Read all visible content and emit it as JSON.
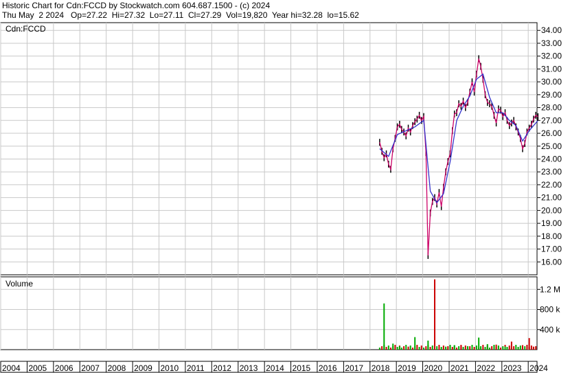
{
  "header": {
    "line1": "Historic Chart for Cdn:FCCD by Stockwatch.com 604.687.1500 - (c) 2024",
    "line2": "Thu May  2 2024   Op=27.22  Hi=27.32  Lo=27.11  Cl=27.29  Vol=19,820  Year hi=32.28  lo=15.62"
  },
  "price_panel": {
    "label": "Cdn:FCCD"
  },
  "volume_panel": {
    "label": "Volume"
  },
  "chart_data": [
    {
      "type": "line",
      "title": "Cdn:FCCD",
      "x_axis_years": [
        "2004",
        "2005",
        "2006",
        "2007",
        "2008",
        "2009",
        "2010",
        "2011",
        "2012",
        "2013",
        "2014",
        "2015",
        "2016",
        "2017",
        "2018",
        "2019",
        "2020",
        "2021",
        "2022",
        "2023",
        "2024"
      ],
      "xlim": [
        "2004-01-01",
        "2024-05-02"
      ],
      "ylim": [
        15.0,
        34.6
      ],
      "y_ticks": [
        "34.00",
        "33.00",
        "32.00",
        "31.00",
        "30.00",
        "29.00",
        "28.00",
        "27.00",
        "26.00",
        "25.00",
        "24.00",
        "23.00",
        "22.00",
        "21.00",
        "20.00",
        "19.00",
        "18.00",
        "17.00",
        "16.00"
      ],
      "grid": true,
      "series": [
        {
          "color": "#cc0066",
          "x": [
            "2018-05",
            "2018-06",
            "2018-07",
            "2018-08",
            "2018-09",
            "2018-10",
            "2018-11",
            "2018-12",
            "2019-01",
            "2019-02",
            "2019-03",
            "2019-04",
            "2019-05",
            "2019-06",
            "2019-07",
            "2019-08",
            "2019-09",
            "2019-10",
            "2019-11",
            "2019-12",
            "2020-01",
            "2020-02",
            "2020-03",
            "2020-04",
            "2020-05",
            "2020-06",
            "2020-07",
            "2020-08",
            "2020-09",
            "2020-10",
            "2020-11",
            "2020-12",
            "2021-01",
            "2021-02",
            "2021-03",
            "2021-04",
            "2021-05",
            "2021-06",
            "2021-07",
            "2021-08",
            "2021-09",
            "2021-10",
            "2021-11",
            "2021-12",
            "2022-01",
            "2022-02",
            "2022-03",
            "2022-04",
            "2022-05",
            "2022-06",
            "2022-07",
            "2022-08",
            "2022-09",
            "2022-10",
            "2022-11",
            "2022-12",
            "2023-01",
            "2023-02",
            "2023-03",
            "2023-04",
            "2023-05",
            "2023-06",
            "2023-07",
            "2023-08",
            "2023-09",
            "2023-10",
            "2023-11",
            "2023-12",
            "2024-01",
            "2024-02",
            "2024-03",
            "2024-04",
            "2024-05"
          ],
          "y": [
            25.3,
            24.6,
            24.1,
            24.4,
            23.6,
            23.2,
            24.8,
            25.6,
            26.5,
            26.7,
            26.3,
            26.1,
            25.8,
            26.4,
            26.1,
            26.6,
            26.9,
            27.1,
            27.4,
            27.0,
            27.3,
            24.5,
            16.5,
            19.8,
            20.7,
            21.0,
            20.5,
            21.4,
            20.3,
            21.8,
            23.0,
            23.8,
            24.4,
            26.2,
            27.5,
            27.6,
            28.3,
            28.1,
            28.5,
            28.0,
            28.4,
            29.2,
            30.0,
            29.2,
            30.6,
            31.8,
            31.2,
            30.2,
            29.0,
            28.4,
            28.3,
            28.1,
            27.4,
            26.8,
            27.9,
            27.8,
            27.3,
            27.6,
            27.0,
            26.6,
            26.8,
            27.0,
            26.5,
            26.1,
            25.6,
            24.8,
            25.2,
            26.1,
            26.4,
            26.7,
            27.1,
            27.4,
            27.29
          ]
        },
        {
          "color": "#3333cc",
          "x": [
            "2018-05",
            "2018-09",
            "2019-01",
            "2019-05",
            "2019-09",
            "2020-01",
            "2020-04",
            "2020-07",
            "2020-10",
            "2021-01",
            "2021-04",
            "2021-07",
            "2021-10",
            "2022-01",
            "2022-04",
            "2022-07",
            "2022-10",
            "2023-01",
            "2023-04",
            "2023-07",
            "2023-10",
            "2024-01",
            "2024-05"
          ],
          "y": [
            24.8,
            24.2,
            25.9,
            26.2,
            26.5,
            27.0,
            21.5,
            20.6,
            21.3,
            23.8,
            27.0,
            28.1,
            28.9,
            30.2,
            30.6,
            28.8,
            27.6,
            27.6,
            27.0,
            26.6,
            25.4,
            26.2,
            27.0
          ]
        }
      ]
    },
    {
      "type": "bar",
      "title": "Volume",
      "ylim": [
        0,
        1450000
      ],
      "y_ticks": [
        "1.2 M",
        "800 k",
        "400 k"
      ],
      "green_spikes": [
        {
          "x": "2018-07",
          "value": 920000
        },
        {
          "x": "2018-11",
          "value": 120000
        },
        {
          "x": "2019-02",
          "value": 70000
        },
        {
          "x": "2019-09",
          "value": 250000
        },
        {
          "x": "2020-03",
          "value": 180000
        },
        {
          "x": "2020-11",
          "value": 60000
        },
        {
          "x": "2021-03",
          "value": 90000
        },
        {
          "x": "2021-09",
          "value": 70000
        },
        {
          "x": "2022-02",
          "value": 240000
        },
        {
          "x": "2022-06",
          "value": 110000
        },
        {
          "x": "2023-02",
          "value": 60000
        },
        {
          "x": "2023-08",
          "value": 55000
        }
      ],
      "red_spikes": [
        {
          "x": "2020-06",
          "value": 1400000
        },
        {
          "x": "2019-06",
          "value": 60000
        },
        {
          "x": "2021-06",
          "value": 70000
        },
        {
          "x": "2022-10",
          "value": 100000
        },
        {
          "x": "2023-05",
          "value": 160000
        },
        {
          "x": "2023-10",
          "value": 90000
        },
        {
          "x": "2024-01",
          "value": 230000
        },
        {
          "x": "2024-03",
          "value": 60000
        }
      ]
    }
  ]
}
